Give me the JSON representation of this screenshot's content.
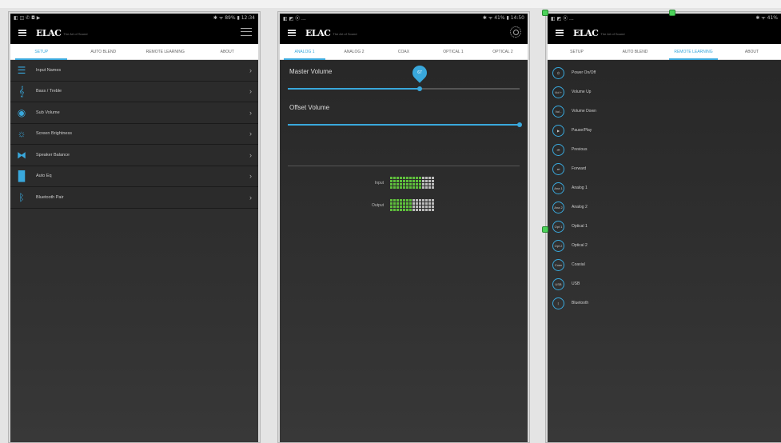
{
  "status": {
    "p1_left": "◧ ◫ ✆ ◘ ▶",
    "p1_right": "✱ ᯤ 89% ▮ 12:34",
    "p2_left": "◧ ◩ ⦿ ...",
    "p2_right": "✱ ᯤ 41% ▮ 14:50",
    "p3_left": "◧ ◩ ⦿ ...",
    "p3_right": "✱ ᯤ 41%"
  },
  "brand": {
    "logo": "ELAC",
    "tagline": "The Art of Sound"
  },
  "screen1": {
    "tabs": [
      "SETUP",
      "AUTO BLEND",
      "REMOTE LEARNING",
      "ABOUT"
    ],
    "active_tab": 0,
    "menu": [
      {
        "label": "Input Names",
        "icon": "list-icon"
      },
      {
        "label": "Bass / Treble",
        "icon": "treble-clef-icon"
      },
      {
        "label": "Sub Volume",
        "icon": "speaker-icon"
      },
      {
        "label": "Screen Brightness",
        "icon": "sun-icon"
      },
      {
        "label": "Speaker Balance",
        "icon": "balance-icon"
      },
      {
        "label": "Auto Eq",
        "icon": "equalizer-icon"
      },
      {
        "label": "Bluetooth Pair",
        "icon": "bluetooth-icon"
      }
    ]
  },
  "screen2": {
    "tabs": [
      "ANALOG 1",
      "ANALOG 2",
      "COAX",
      "OPTICAL 1",
      "OPTICAL 2"
    ],
    "active_tab": 0,
    "master_label": "Master Volume",
    "master_value": "67",
    "master_fraction": 0.57,
    "offset_label": "Offset Volume",
    "offset_fraction": 1.0,
    "meters": [
      {
        "label": "Input",
        "lit": 10,
        "total": 14
      },
      {
        "label": "Output",
        "lit": 7,
        "total": 14
      }
    ]
  },
  "screen3": {
    "tabs": [
      "SETUP",
      "AUTO BLEND",
      "REMOTE LEARNING",
      "ABOUT"
    ],
    "active_tab": 2,
    "buttons": [
      {
        "code": "⏻",
        "label": "Power On/Off"
      },
      {
        "code": "Vol +",
        "label": "Volume Up"
      },
      {
        "code": "Vol -",
        "label": "Volume Down"
      },
      {
        "code": "▶",
        "label": "Pause/Play"
      },
      {
        "code": "⏮",
        "label": "Previous"
      },
      {
        "code": "⏭",
        "label": "Forward"
      },
      {
        "code": "Ana 1",
        "label": "Analog 1"
      },
      {
        "code": "Ana 2",
        "label": "Analog 2"
      },
      {
        "code": "Opt 1",
        "label": "Optical 1"
      },
      {
        "code": "Opt 2",
        "label": "Optical 2"
      },
      {
        "code": "Coax",
        "label": "Coaxial"
      },
      {
        "code": "USB",
        "label": "USB"
      },
      {
        "code": "ᛒ",
        "label": "Bluetooth"
      }
    ]
  },
  "colors": {
    "accent": "#39a8dc",
    "meter_on": "#5fbf3c",
    "meter_off": "#bbbbbb",
    "handle": "#4cd25a"
  }
}
